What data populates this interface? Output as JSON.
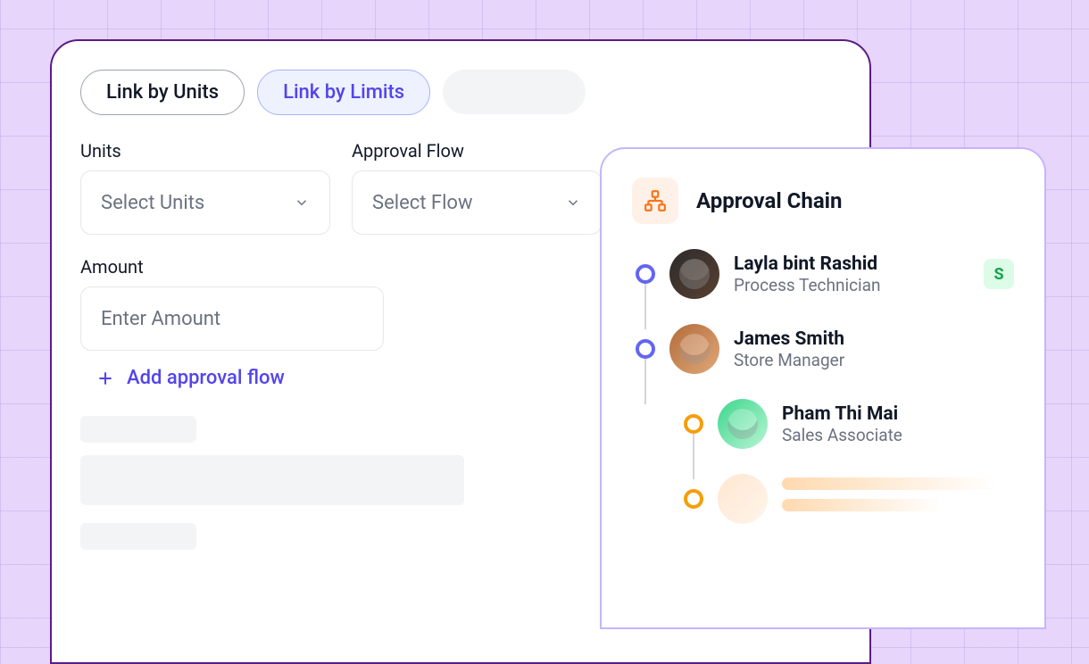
{
  "tabs": {
    "units": "Link by Units",
    "limits": "Link by Limits"
  },
  "form": {
    "units_label": "Units",
    "units_placeholder": "Select Units",
    "flow_label": "Approval Flow",
    "flow_placeholder": "Select Flow",
    "amount_label": "Amount",
    "amount_placeholder": "Enter Amount",
    "add_flow": "Add approval flow"
  },
  "chain": {
    "title": "Approval Chain",
    "badge": "S",
    "people": [
      {
        "name": "Layla bint Rashid",
        "role": "Process Technician"
      },
      {
        "name": "James Smith",
        "role": "Store Manager"
      },
      {
        "name": "Pham Thi Mai",
        "role": "Sales Associate"
      }
    ]
  }
}
